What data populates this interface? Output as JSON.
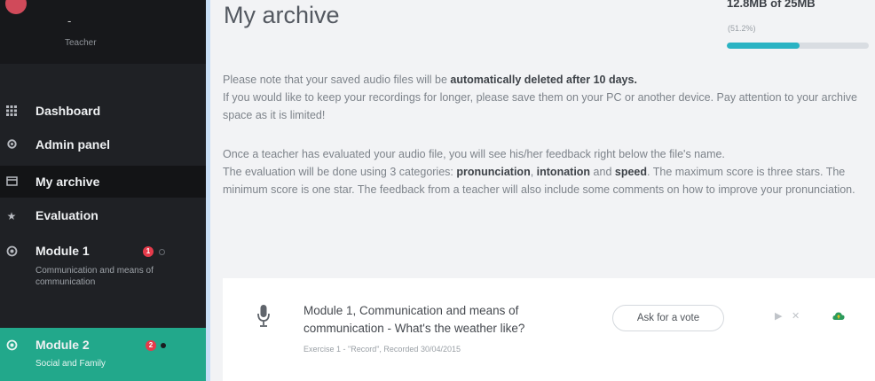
{
  "sidebar": {
    "profile": {
      "name": "",
      "dash": "-",
      "role": "Teacher"
    },
    "items": [
      {
        "label": "Dashboard",
        "icon": "grid-icon"
      },
      {
        "label": "Admin panel",
        "icon": "gear-icon"
      },
      {
        "label": "My archive",
        "icon": "archive-icon"
      },
      {
        "label": "Evaluation",
        "icon": "star-icon"
      },
      {
        "label": "Module 1",
        "icon": "module-icon",
        "subtitle": "Communication and means of communication",
        "badge": "1"
      },
      {
        "label": "Module 2",
        "icon": "module-icon",
        "subtitle": "Social and Family",
        "badge": "2"
      }
    ]
  },
  "main": {
    "title": "My archive",
    "quota": {
      "text": "12.8MB of 25MB",
      "percent_label": "(51.2%)",
      "fraction": 0.512
    },
    "notice": {
      "p1_a": "Please note that your saved audio files will be ",
      "p1_b": "automatically deleted after 10 days.",
      "p1_c": "If you would like to keep your recordings for longer, please save them on your PC or another device. Pay attention to your archive space as it is limited!",
      "p2_a": "Once a teacher has evaluated your audio file, you will see his/her feedback right below the file's name.",
      "p2_b": "The evaluation will be done using 3 categories: ",
      "p2_c": "pronunciation",
      "p2_d": ", ",
      "p2_e": "intonation",
      "p2_f": " and ",
      "p2_g": "speed",
      "p2_h": ". The maximum score is three stars. The minimum score is one star. The feedback from a teacher will also include some comments on how to improve your pronunciation."
    },
    "file": {
      "title": "Module 1, Communication and means of communication - What's the weather like?",
      "meta": "Exercise 1 - \"Record\", Recorded 30/04/2015",
      "ask_label": "Ask for a vote",
      "play_icon": "play-icon",
      "delete_icon": "close-icon",
      "cloud_icon": "cloud-upload-icon"
    }
  },
  "colors": {
    "sidebar_bg": "#1f2125",
    "accent_green": "#22a88b",
    "badge_red": "#e53b4b",
    "quota_fill": "#2ab3c3"
  }
}
